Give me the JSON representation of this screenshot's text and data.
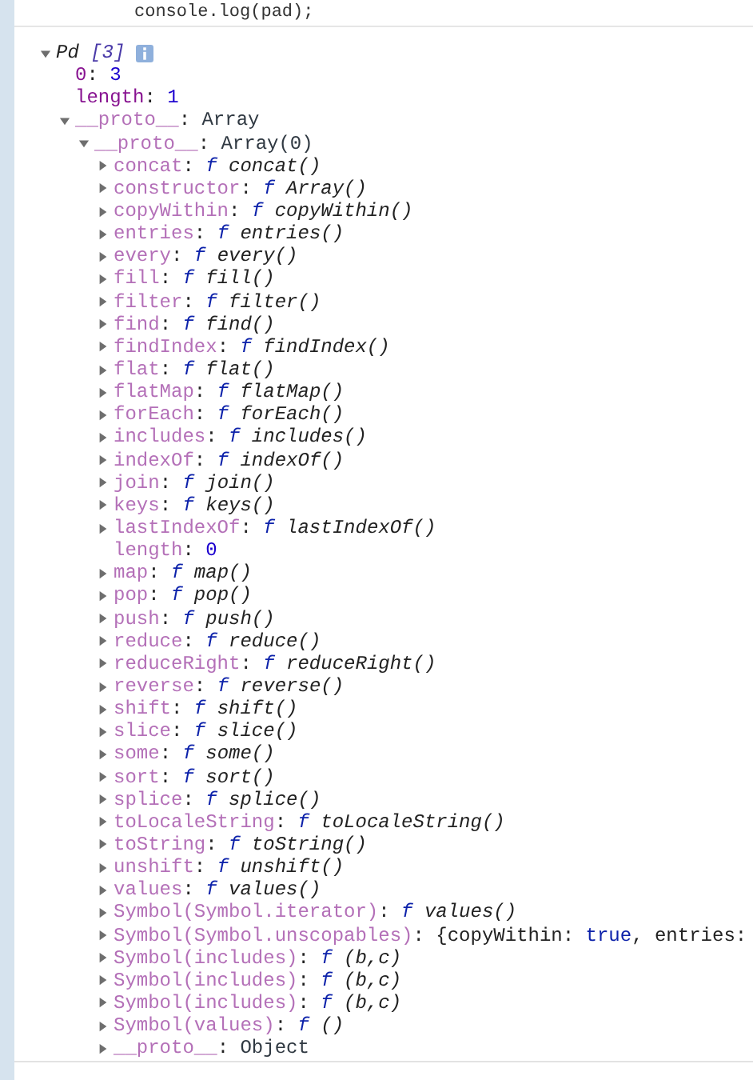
{
  "code_line": "console.log(pad);",
  "tree": {
    "expanded": true,
    "info": true,
    "label": [
      {
        "t": "Pd",
        "kind": "italic"
      },
      {
        "t": " [3]",
        "kind": "count"
      }
    ],
    "children": [
      {
        "key": "0",
        "dim": false,
        "value": [
          {
            "t": ": "
          },
          {
            "t": "3",
            "kind": "num"
          }
        ]
      },
      {
        "key": "length",
        "dim": false,
        "value": [
          {
            "t": ": "
          },
          {
            "t": "1",
            "kind": "num"
          }
        ]
      },
      {
        "key": "__proto__",
        "dim": true,
        "expanded": true,
        "value": [
          {
            "t": ": "
          },
          {
            "t": "Array",
            "kind": "obj"
          }
        ],
        "children": [
          {
            "key": "__proto__",
            "dim": true,
            "expanded": true,
            "value": [
              {
                "t": ": "
              },
              {
                "t": "Array(0)",
                "kind": "obj"
              }
            ],
            "children": [
              {
                "key": "concat",
                "dim": true,
                "expanded": false,
                "value": [
                  {
                    "t": ": "
                  },
                  {
                    "t": "f",
                    "kind": "fn"
                  },
                  {
                    "t": " concat()",
                    "kind": "sig"
                  }
                ]
              },
              {
                "key": "constructor",
                "dim": true,
                "expanded": false,
                "value": [
                  {
                    "t": ": "
                  },
                  {
                    "t": "f",
                    "kind": "fn"
                  },
                  {
                    "t": " Array()",
                    "kind": "sig"
                  }
                ]
              },
              {
                "key": "copyWithin",
                "dim": true,
                "expanded": false,
                "value": [
                  {
                    "t": ": "
                  },
                  {
                    "t": "f",
                    "kind": "fn"
                  },
                  {
                    "t": " copyWithin()",
                    "kind": "sig"
                  }
                ]
              },
              {
                "key": "entries",
                "dim": true,
                "expanded": false,
                "value": [
                  {
                    "t": ": "
                  },
                  {
                    "t": "f",
                    "kind": "fn"
                  },
                  {
                    "t": " entries()",
                    "kind": "sig"
                  }
                ]
              },
              {
                "key": "every",
                "dim": true,
                "expanded": false,
                "value": [
                  {
                    "t": ": "
                  },
                  {
                    "t": "f",
                    "kind": "fn"
                  },
                  {
                    "t": " every()",
                    "kind": "sig"
                  }
                ]
              },
              {
                "key": "fill",
                "dim": true,
                "expanded": false,
                "value": [
                  {
                    "t": ": "
                  },
                  {
                    "t": "f",
                    "kind": "fn"
                  },
                  {
                    "t": " fill()",
                    "kind": "sig"
                  }
                ]
              },
              {
                "key": "filter",
                "dim": true,
                "expanded": false,
                "value": [
                  {
                    "t": ": "
                  },
                  {
                    "t": "f",
                    "kind": "fn"
                  },
                  {
                    "t": " filter()",
                    "kind": "sig"
                  }
                ]
              },
              {
                "key": "find",
                "dim": true,
                "expanded": false,
                "value": [
                  {
                    "t": ": "
                  },
                  {
                    "t": "f",
                    "kind": "fn"
                  },
                  {
                    "t": " find()",
                    "kind": "sig"
                  }
                ]
              },
              {
                "key": "findIndex",
                "dim": true,
                "expanded": false,
                "value": [
                  {
                    "t": ": "
                  },
                  {
                    "t": "f",
                    "kind": "fn"
                  },
                  {
                    "t": " findIndex()",
                    "kind": "sig"
                  }
                ]
              },
              {
                "key": "flat",
                "dim": true,
                "expanded": false,
                "value": [
                  {
                    "t": ": "
                  },
                  {
                    "t": "f",
                    "kind": "fn"
                  },
                  {
                    "t": " flat()",
                    "kind": "sig"
                  }
                ]
              },
              {
                "key": "flatMap",
                "dim": true,
                "expanded": false,
                "value": [
                  {
                    "t": ": "
                  },
                  {
                    "t": "f",
                    "kind": "fn"
                  },
                  {
                    "t": " flatMap()",
                    "kind": "sig"
                  }
                ]
              },
              {
                "key": "forEach",
                "dim": true,
                "expanded": false,
                "value": [
                  {
                    "t": ": "
                  },
                  {
                    "t": "f",
                    "kind": "fn"
                  },
                  {
                    "t": " forEach()",
                    "kind": "sig"
                  }
                ]
              },
              {
                "key": "includes",
                "dim": true,
                "expanded": false,
                "value": [
                  {
                    "t": ": "
                  },
                  {
                    "t": "f",
                    "kind": "fn"
                  },
                  {
                    "t": " includes()",
                    "kind": "sig"
                  }
                ]
              },
              {
                "key": "indexOf",
                "dim": true,
                "expanded": false,
                "value": [
                  {
                    "t": ": "
                  },
                  {
                    "t": "f",
                    "kind": "fn"
                  },
                  {
                    "t": " indexOf()",
                    "kind": "sig"
                  }
                ]
              },
              {
                "key": "join",
                "dim": true,
                "expanded": false,
                "value": [
                  {
                    "t": ": "
                  },
                  {
                    "t": "f",
                    "kind": "fn"
                  },
                  {
                    "t": " join()",
                    "kind": "sig"
                  }
                ]
              },
              {
                "key": "keys",
                "dim": true,
                "expanded": false,
                "value": [
                  {
                    "t": ": "
                  },
                  {
                    "t": "f",
                    "kind": "fn"
                  },
                  {
                    "t": " keys()",
                    "kind": "sig"
                  }
                ]
              },
              {
                "key": "lastIndexOf",
                "dim": true,
                "expanded": false,
                "value": [
                  {
                    "t": ": "
                  },
                  {
                    "t": "f",
                    "kind": "fn"
                  },
                  {
                    "t": " lastIndexOf()",
                    "kind": "sig"
                  }
                ]
              },
              {
                "key": "length",
                "dim": true,
                "value": [
                  {
                    "t": ": "
                  },
                  {
                    "t": "0",
                    "kind": "num"
                  }
                ]
              },
              {
                "key": "map",
                "dim": true,
                "expanded": false,
                "value": [
                  {
                    "t": ": "
                  },
                  {
                    "t": "f",
                    "kind": "fn"
                  },
                  {
                    "t": " map()",
                    "kind": "sig"
                  }
                ]
              },
              {
                "key": "pop",
                "dim": true,
                "expanded": false,
                "value": [
                  {
                    "t": ": "
                  },
                  {
                    "t": "f",
                    "kind": "fn"
                  },
                  {
                    "t": " pop()",
                    "kind": "sig"
                  }
                ]
              },
              {
                "key": "push",
                "dim": true,
                "expanded": false,
                "value": [
                  {
                    "t": ": "
                  },
                  {
                    "t": "f",
                    "kind": "fn"
                  },
                  {
                    "t": " push()",
                    "kind": "sig"
                  }
                ]
              },
              {
                "key": "reduce",
                "dim": true,
                "expanded": false,
                "value": [
                  {
                    "t": ": "
                  },
                  {
                    "t": "f",
                    "kind": "fn"
                  },
                  {
                    "t": " reduce()",
                    "kind": "sig"
                  }
                ]
              },
              {
                "key": "reduceRight",
                "dim": true,
                "expanded": false,
                "value": [
                  {
                    "t": ": "
                  },
                  {
                    "t": "f",
                    "kind": "fn"
                  },
                  {
                    "t": " reduceRight()",
                    "kind": "sig"
                  }
                ]
              },
              {
                "key": "reverse",
                "dim": true,
                "expanded": false,
                "value": [
                  {
                    "t": ": "
                  },
                  {
                    "t": "f",
                    "kind": "fn"
                  },
                  {
                    "t": " reverse()",
                    "kind": "sig"
                  }
                ]
              },
              {
                "key": "shift",
                "dim": true,
                "expanded": false,
                "value": [
                  {
                    "t": ": "
                  },
                  {
                    "t": "f",
                    "kind": "fn"
                  },
                  {
                    "t": " shift()",
                    "kind": "sig"
                  }
                ]
              },
              {
                "key": "slice",
                "dim": true,
                "expanded": false,
                "value": [
                  {
                    "t": ": "
                  },
                  {
                    "t": "f",
                    "kind": "fn"
                  },
                  {
                    "t": " slice()",
                    "kind": "sig"
                  }
                ]
              },
              {
                "key": "some",
                "dim": true,
                "expanded": false,
                "value": [
                  {
                    "t": ": "
                  },
                  {
                    "t": "f",
                    "kind": "fn"
                  },
                  {
                    "t": " some()",
                    "kind": "sig"
                  }
                ]
              },
              {
                "key": "sort",
                "dim": true,
                "expanded": false,
                "value": [
                  {
                    "t": ": "
                  },
                  {
                    "t": "f",
                    "kind": "fn"
                  },
                  {
                    "t": " sort()",
                    "kind": "sig"
                  }
                ]
              },
              {
                "key": "splice",
                "dim": true,
                "expanded": false,
                "value": [
                  {
                    "t": ": "
                  },
                  {
                    "t": "f",
                    "kind": "fn"
                  },
                  {
                    "t": " splice()",
                    "kind": "sig"
                  }
                ]
              },
              {
                "key": "toLocaleString",
                "dim": true,
                "expanded": false,
                "value": [
                  {
                    "t": ": "
                  },
                  {
                    "t": "f",
                    "kind": "fn"
                  },
                  {
                    "t": " toLocaleString()",
                    "kind": "sig"
                  }
                ]
              },
              {
                "key": "toString",
                "dim": true,
                "expanded": false,
                "value": [
                  {
                    "t": ": "
                  },
                  {
                    "t": "f",
                    "kind": "fn"
                  },
                  {
                    "t": " toString()",
                    "kind": "sig"
                  }
                ]
              },
              {
                "key": "unshift",
                "dim": true,
                "expanded": false,
                "value": [
                  {
                    "t": ": "
                  },
                  {
                    "t": "f",
                    "kind": "fn"
                  },
                  {
                    "t": " unshift()",
                    "kind": "sig"
                  }
                ]
              },
              {
                "key": "values",
                "dim": true,
                "expanded": false,
                "value": [
                  {
                    "t": ": "
                  },
                  {
                    "t": "f",
                    "kind": "fn"
                  },
                  {
                    "t": " values()",
                    "kind": "sig"
                  }
                ]
              },
              {
                "key": "Symbol(Symbol.iterator)",
                "dim": true,
                "expanded": false,
                "value": [
                  {
                    "t": ": "
                  },
                  {
                    "t": "f",
                    "kind": "fn"
                  },
                  {
                    "t": " values()",
                    "kind": "sig"
                  }
                ]
              },
              {
                "key": "Symbol(Symbol.unscopables)",
                "dim": true,
                "expanded": false,
                "value": [
                  {
                    "t": ": {copyWithin: "
                  },
                  {
                    "t": "true",
                    "kind": "bool"
                  },
                  {
                    "t": ", entries:"
                  }
                ]
              },
              {
                "key": "Symbol(includes)",
                "dim": true,
                "expanded": false,
                "value": [
                  {
                    "t": ": "
                  },
                  {
                    "t": "f",
                    "kind": "fn"
                  },
                  {
                    "t": " (b,c)",
                    "kind": "sig"
                  }
                ]
              },
              {
                "key": "Symbol(includes)",
                "dim": true,
                "expanded": false,
                "value": [
                  {
                    "t": ": "
                  },
                  {
                    "t": "f",
                    "kind": "fn"
                  },
                  {
                    "t": " (b,c)",
                    "kind": "sig"
                  }
                ]
              },
              {
                "key": "Symbol(includes)",
                "dim": true,
                "expanded": false,
                "value": [
                  {
                    "t": ": "
                  },
                  {
                    "t": "f",
                    "kind": "fn"
                  },
                  {
                    "t": " (b,c)",
                    "kind": "sig"
                  }
                ]
              },
              {
                "key": "Symbol(values)",
                "dim": true,
                "expanded": false,
                "value": [
                  {
                    "t": ": "
                  },
                  {
                    "t": "f",
                    "kind": "fn"
                  },
                  {
                    "t": " ()",
                    "kind": "sig"
                  }
                ]
              },
              {
                "key": "__proto__",
                "dim": true,
                "expanded": false,
                "value": [
                  {
                    "t": ": "
                  },
                  {
                    "t": "Object",
                    "kind": "obj"
                  }
                ]
              }
            ]
          }
        ]
      }
    ]
  }
}
